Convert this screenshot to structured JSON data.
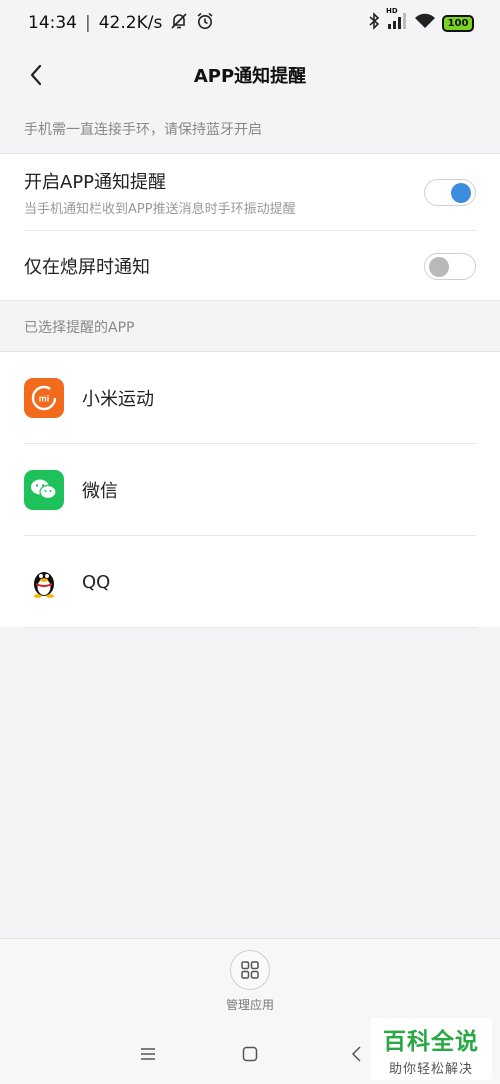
{
  "status_bar": {
    "time": "14:34",
    "separator": "|",
    "net_speed": "42.2K/s",
    "hd_label": "HD",
    "battery": "100",
    "icons": [
      "mute-bell-icon",
      "alarm-icon",
      "bluetooth-icon",
      "signal-icon",
      "wifi-icon",
      "battery-icon"
    ]
  },
  "header": {
    "title": "APP通知提醒",
    "back_icon": "chevron-left-icon"
  },
  "notice": "手机需一直连接手环，请保持蓝牙开启",
  "settings": {
    "enable": {
      "label": "开启APP通知提醒",
      "sub": "当手机通知栏收到APP推送消息时手环振动提醒",
      "on": true
    },
    "screen_off": {
      "label": "仅在熄屏时通知",
      "on": false
    }
  },
  "apps_section_title": "已选择提醒的APP",
  "apps": [
    {
      "name": "小米运动",
      "icon": "mi-fit-icon",
      "color": "#f26a1b",
      "logo_text": "mi"
    },
    {
      "name": "微信",
      "icon": "wechat-icon",
      "color": "#1fc25a"
    },
    {
      "name": "QQ",
      "icon": "qq-penguin-icon"
    }
  ],
  "bottom": {
    "manage_label": "管理应用",
    "manage_icon": "grid-icon"
  },
  "nav": {
    "icons": [
      "menu-icon",
      "home-square-icon",
      "back-triangle-icon"
    ]
  },
  "watermark": {
    "main": "百科全说",
    "sub": "助你轻松解决"
  },
  "colors": {
    "accent": "#3c8de0",
    "background": "#f4f4f6",
    "watermark_green": "#2aa845"
  }
}
